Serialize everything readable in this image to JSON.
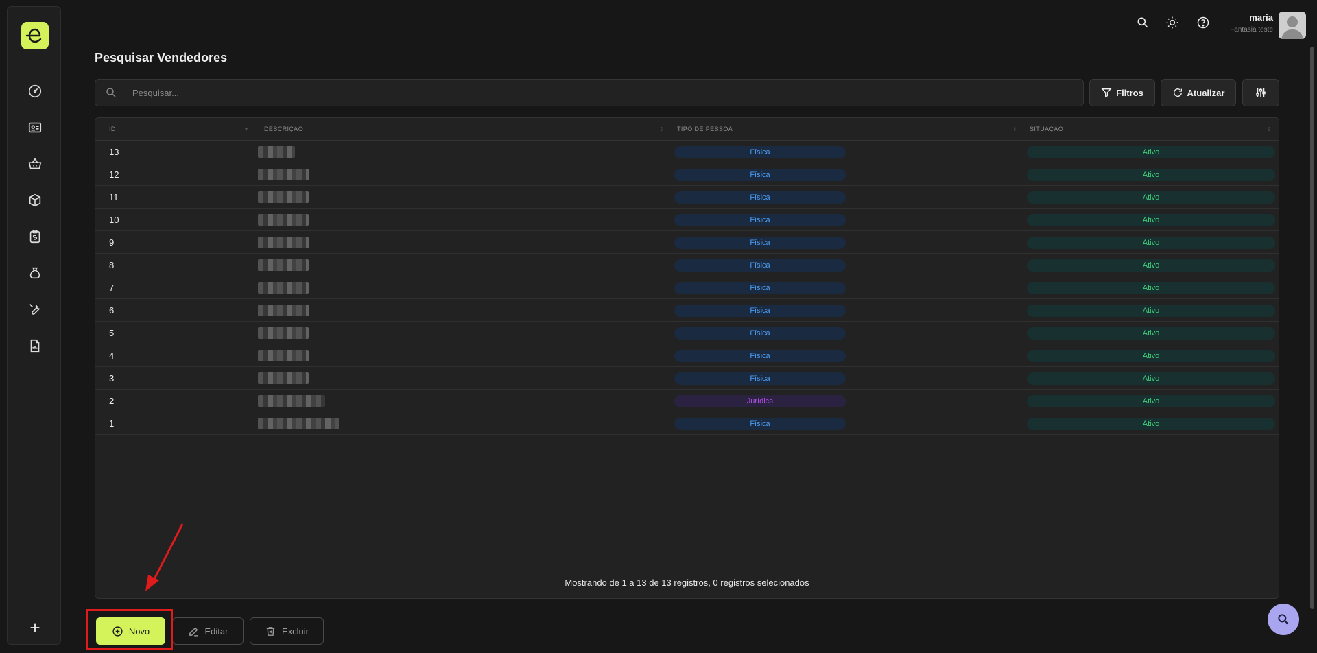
{
  "header": {
    "user_name": "maria",
    "user_company": "Fantasia teste"
  },
  "page": {
    "title": "Pesquisar Vendedores"
  },
  "search": {
    "placeholder": "Pesquisar..."
  },
  "toolbar": {
    "filters_label": "Filtros",
    "refresh_label": "Atualizar"
  },
  "table": {
    "columns": [
      "ID",
      "DESCRIÇÃO",
      "TIPO DE PESSOA",
      "SITUAÇÃO"
    ],
    "rows": [
      {
        "id": "13",
        "tipo": "Física",
        "situacao": "Ativo"
      },
      {
        "id": "12",
        "tipo": "Física",
        "situacao": "Ativo"
      },
      {
        "id": "11",
        "tipo": "Física",
        "situacao": "Ativo"
      },
      {
        "id": "10",
        "tipo": "Física",
        "situacao": "Ativo"
      },
      {
        "id": "9",
        "tipo": "Física",
        "situacao": "Ativo"
      },
      {
        "id": "8",
        "tipo": "Física",
        "situacao": "Ativo"
      },
      {
        "id": "7",
        "tipo": "Física",
        "situacao": "Ativo"
      },
      {
        "id": "6",
        "tipo": "Física",
        "situacao": "Ativo"
      },
      {
        "id": "5",
        "tipo": "Física",
        "situacao": "Ativo"
      },
      {
        "id": "4",
        "tipo": "Física",
        "situacao": "Ativo"
      },
      {
        "id": "3",
        "tipo": "Física",
        "situacao": "Ativo"
      },
      {
        "id": "2",
        "tipo": "Jurídica",
        "situacao": "Ativo"
      },
      {
        "id": "1",
        "tipo": "Física",
        "situacao": "Ativo"
      }
    ],
    "footer": "Mostrando de 1 a 13 de 13 registros, 0 registros selecionados"
  },
  "actions": {
    "new_label": "Novo",
    "edit_label": "Editar",
    "delete_label": "Excluir"
  },
  "colors": {
    "accent": "#d4f35a",
    "annotation": "#e01b1b",
    "fisica": "#4d9df3",
    "juridica": "#b24fe6",
    "ativo": "#3ed17a"
  },
  "icons": {
    "sidebar": [
      "dashboard-icon",
      "id-card-icon",
      "basket-icon",
      "box-icon",
      "clipboard-dollar-icon",
      "money-bag-icon",
      "wrench-icon",
      "report-icon",
      "plus-icon"
    ],
    "topbar": [
      "search-icon",
      "sun-icon",
      "help-icon"
    ]
  }
}
